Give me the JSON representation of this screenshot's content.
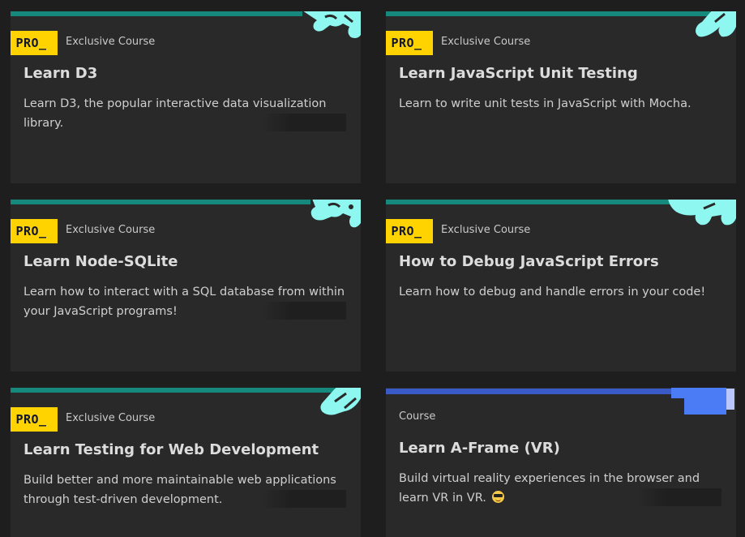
{
  "colors": {
    "pro_bar": "#14897c",
    "course_bar": "#3a5bc7",
    "badge": "#ffd300",
    "art_cyan": "#8ef8f0",
    "art_blue": "#4b7bf5"
  },
  "badge_label": "PRO_",
  "cards": [
    {
      "kind": "Exclusive Course",
      "title": "Learn D3",
      "description": "Learn D3, the popular interactive data visualization library."
    },
    {
      "kind": "Exclusive Course",
      "title": "Learn JavaScript Unit Testing",
      "description": "Learn to write unit tests in JavaScript with Mocha."
    },
    {
      "kind": "Exclusive Course",
      "title": "Learn Node-SQLite",
      "description": "Learn how to interact with a SQL database from within your JavaScript programs!"
    },
    {
      "kind": "Exclusive Course",
      "title": "How to Debug JavaScript Errors",
      "description": "Learn how to debug and handle errors in your code!"
    },
    {
      "kind": "Exclusive Course",
      "title": "Learn Testing for Web Development",
      "description": "Build better and more maintainable web applications through test-driven development."
    },
    {
      "kind": "Course",
      "title": "Learn A-Frame (VR)",
      "description": "Build virtual reality experiences in the browser and learn VR in VR.",
      "emoji": "sunglasses-emoji"
    }
  ]
}
